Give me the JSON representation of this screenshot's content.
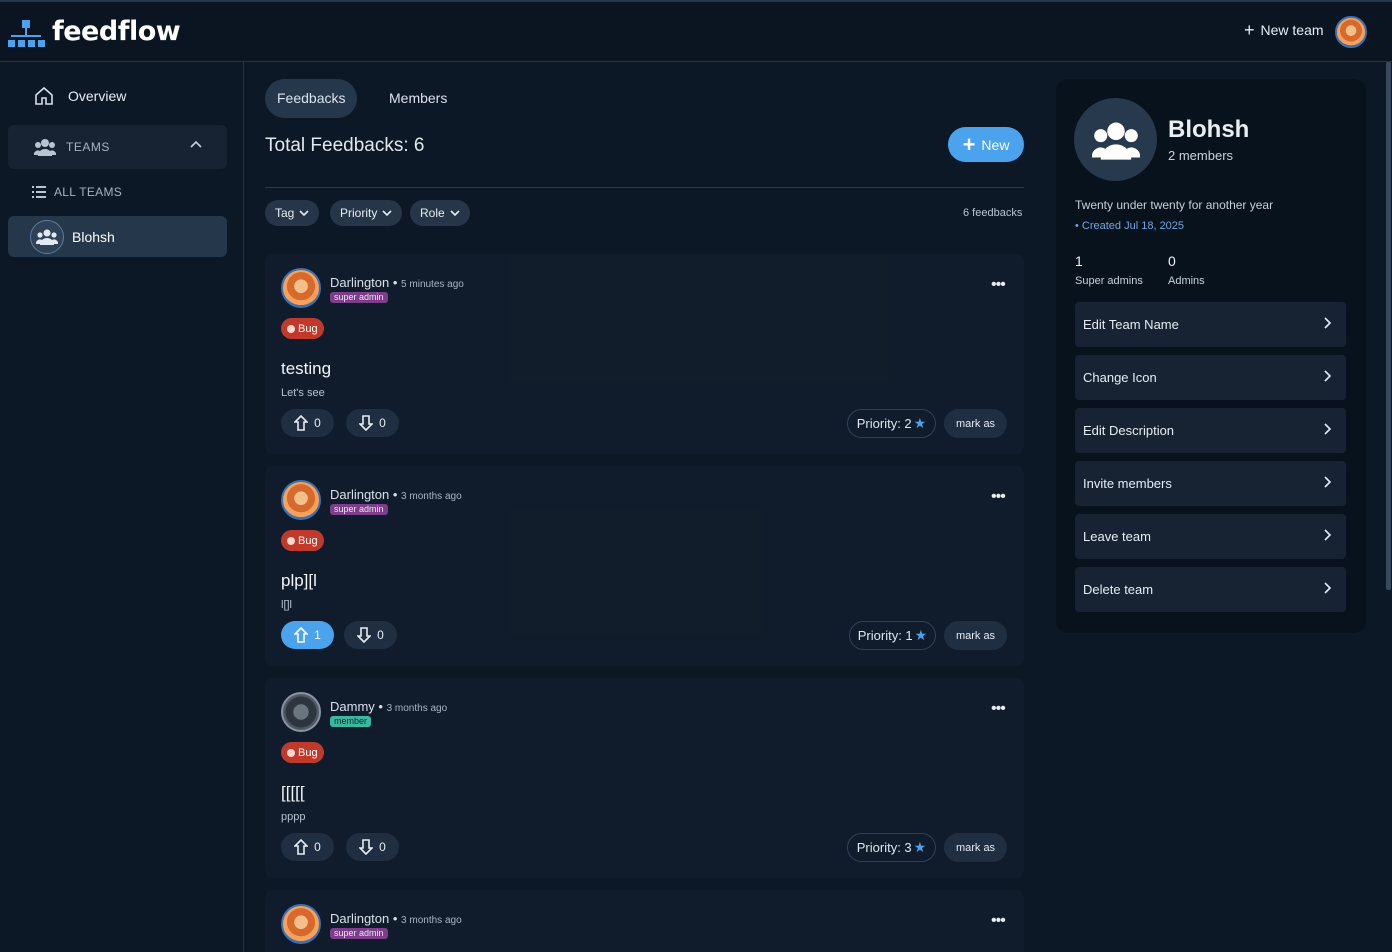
{
  "header": {
    "brand": "feedflow",
    "new_team_label": "New team"
  },
  "sidebar": {
    "overview_label": "Overview",
    "teams_label": "TEAMS",
    "all_teams_label": "ALL TEAMS",
    "teams": [
      {
        "name": "Blohsh"
      }
    ]
  },
  "main": {
    "tabs": [
      {
        "label": "Feedbacks",
        "active": true
      },
      {
        "label": "Members",
        "active": false
      }
    ],
    "total_label": "Total Feedbacks: 6",
    "new_button_label": "New",
    "filters": [
      {
        "label": "Tag"
      },
      {
        "label": "Priority"
      },
      {
        "label": "Role"
      }
    ],
    "feedback_count_label": "6 feedbacks",
    "feedbacks": [
      {
        "author": "Darlington",
        "time": "5 minutes ago",
        "role": "super admin",
        "tag": "Bug",
        "title": "testing",
        "body": "Let's see",
        "upvotes": "0",
        "downvotes": "0",
        "priority": "Priority: 2",
        "mark_label": "mark as"
      },
      {
        "author": "Darlington",
        "time": "3 months ago",
        "role": "super admin",
        "tag": "Bug",
        "title": "plp][l",
        "body": "l[]l",
        "upvotes": "1",
        "downvotes": "0",
        "priority": "Priority: 1",
        "mark_label": "mark as"
      },
      {
        "author": "Dammy",
        "time": "3 months ago",
        "role": "member",
        "tag": "Bug",
        "title": "[[[[[",
        "body": "pppp",
        "upvotes": "0",
        "downvotes": "0",
        "priority": "Priority: 3",
        "mark_label": "mark as"
      },
      {
        "author": "Darlington",
        "time": "3 months ago",
        "role": "super admin"
      }
    ]
  },
  "panel": {
    "team_name": "Blohsh",
    "members_label": "2 members",
    "description": "Twenty under twenty for another year",
    "created": "• Created Jul 18, 2025",
    "stats": [
      {
        "value": "1",
        "label": "Super admins"
      },
      {
        "value": "0",
        "label": "Admins"
      }
    ],
    "actions": [
      {
        "label": "Edit Team Name"
      },
      {
        "label": "Change Icon"
      },
      {
        "label": "Edit Description"
      },
      {
        "label": "Invite members"
      },
      {
        "label": "Leave team"
      },
      {
        "label": "Delete team"
      }
    ]
  },
  "colors": {
    "accent": "#4aa3ec",
    "background": "#0d1826",
    "bug_tag": "#c1392b",
    "super_admin_badge": "#7d3d8a",
    "member_badge": "#3bb8a2"
  }
}
